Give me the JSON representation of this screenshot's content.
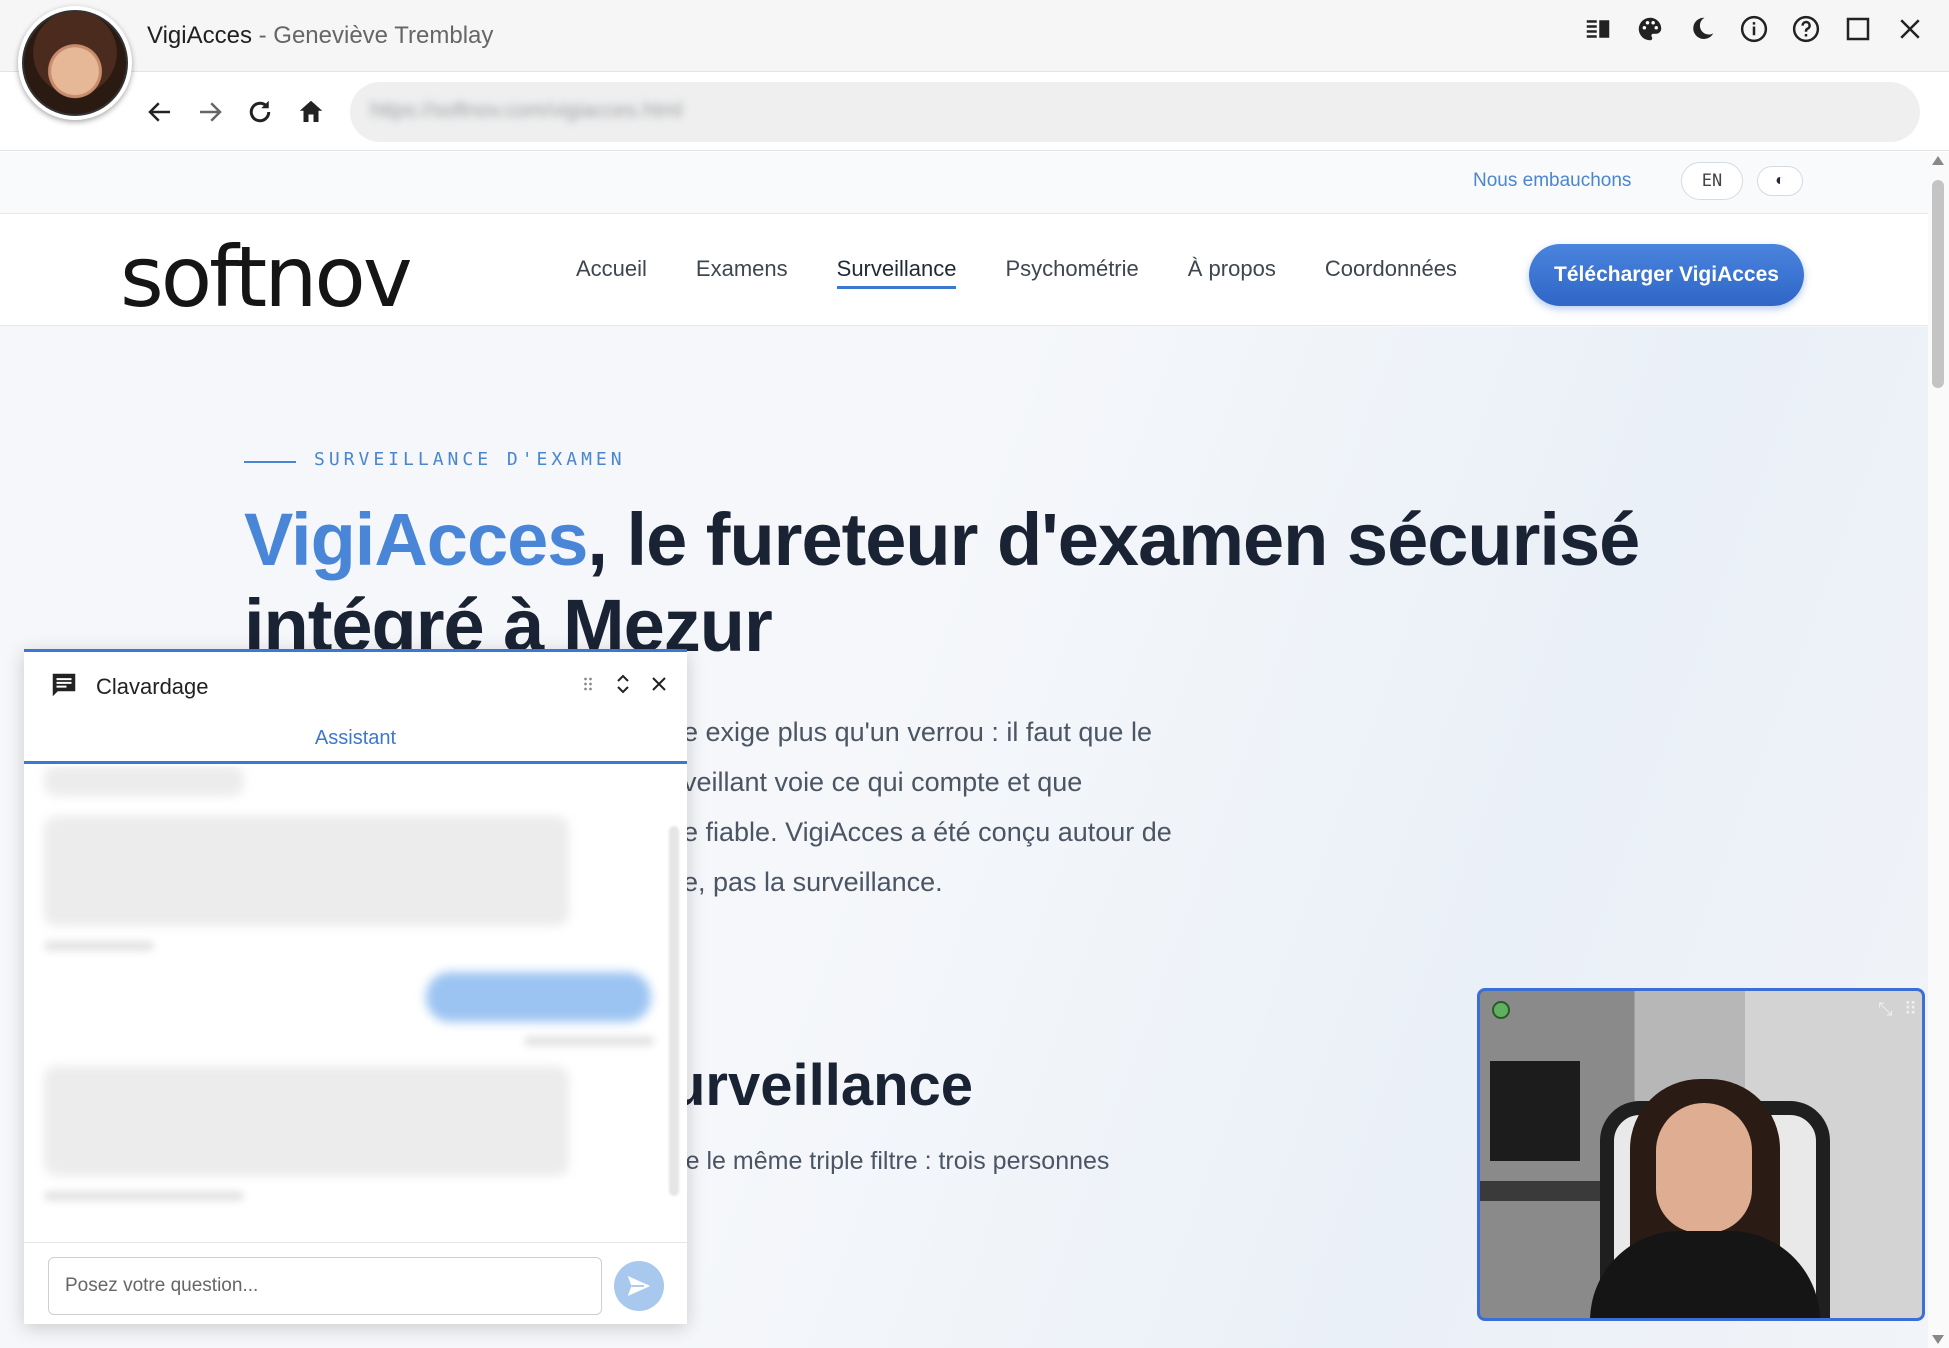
{
  "window": {
    "app_name": "VigiAcces",
    "separator": " - ",
    "user_name": "Geneviève Tremblay",
    "icons": [
      "reader-icon",
      "palette-icon",
      "moon-icon",
      "info-icon",
      "help-icon",
      "maximize-icon",
      "close-icon"
    ]
  },
  "toolbar": {
    "url": "https://softnov.com/vigiacces.html"
  },
  "site": {
    "hiring": "Nous embauchons",
    "lang": "EN",
    "theme_toggle": "◐",
    "logo": "softnov",
    "nav": [
      "Accueil",
      "Examens",
      "Surveillance",
      "Psychométrie",
      "À propos",
      "Coordonnées"
    ],
    "active_nav": "Surveillance",
    "cta": "Télécharger VigiAcces",
    "eyebrow": "SURVEILLANCE D'EXAMEN",
    "headline_brand": "VigiAcces",
    "headline_rest": ", le fureteur d'examen sécurisé intégré à Mezur",
    "lead_lines": [
      "e exige plus qu'un verrou : il faut que le",
      "veillant voie ce qui compte et que",
      "e fiable. VigiAcces a été conçu autour de",
      "e, pas la surveillance."
    ],
    "section_title": "urveillance",
    "section_text": "Chaque décision de conception de VigiAcces passe le même triple filtre : trois personnes"
  },
  "chat": {
    "title": "Clavardage",
    "tab": "Assistant",
    "input_placeholder": "Posez votre question..."
  }
}
